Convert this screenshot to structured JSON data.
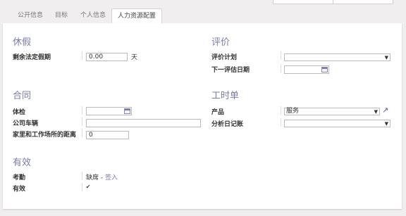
{
  "tabs": [
    "公开信息",
    "目标",
    "个人信息",
    "人力资源配置"
  ],
  "sections": {
    "leave": {
      "title": "休假",
      "label": "剩余法定假期",
      "value": "0.00",
      "unit": "天"
    },
    "appraisal": {
      "title": "评价",
      "plan_label": "评价计划",
      "plan_value": "",
      "next_label": "下一评估日期",
      "next_value": ""
    },
    "contract": {
      "title": "合同",
      "medical_label": "体检",
      "medical_value": "",
      "car_label": "公司车辆",
      "car_value": "",
      "km_label": "家里和工作场所的距离",
      "km_value": "0"
    },
    "timesheet": {
      "title": "工时单",
      "product_label": "产品",
      "product_value": "服务",
      "journal_label": "分析日记账",
      "journal_value": ""
    },
    "active": {
      "title": "有效",
      "attendance_label": "考勤",
      "attendance_status": "缺席",
      "attendance_sep": " - ",
      "attendance_action": "签入",
      "active_label": "有效",
      "active_checked": "✔"
    }
  }
}
